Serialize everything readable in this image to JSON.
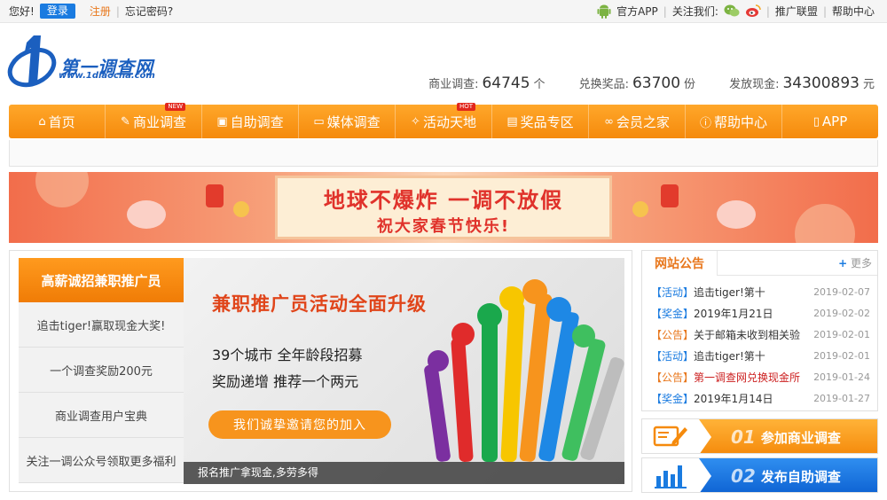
{
  "topbar": {
    "greeting": "您好!",
    "login": "登录",
    "register": "注册",
    "forgot": "忘记密码?",
    "app_label": "官方APP",
    "follow_label": "关注我们:",
    "affiliate": "推广联盟",
    "help": "帮助中心"
  },
  "logo": {
    "name": "第一调查网",
    "url": "www.1diaocha.com"
  },
  "stats": [
    {
      "label": "商业调查:",
      "value": "64745",
      "unit": "个"
    },
    {
      "label": "兑换奖品:",
      "value": "63700",
      "unit": "份"
    },
    {
      "label": "发放现金:",
      "value": "34300893",
      "unit": "元"
    }
  ],
  "nav": [
    {
      "label": "首页",
      "icon": "home-icon",
      "glyph": "⌂"
    },
    {
      "label": "商业调查",
      "icon": "pen-icon",
      "glyph": "✎",
      "badge": "NEW"
    },
    {
      "label": "自助调查",
      "icon": "box-icon",
      "glyph": "▣"
    },
    {
      "label": "媒体调查",
      "icon": "monitor-icon",
      "glyph": "▭"
    },
    {
      "label": "活动天地",
      "icon": "activity-icon",
      "glyph": "✧",
      "badge": "HOT"
    },
    {
      "label": "奖品专区",
      "icon": "gift-icon",
      "glyph": "▤"
    },
    {
      "label": "会员之家",
      "icon": "members-icon",
      "glyph": "∞"
    },
    {
      "label": "帮助中心",
      "icon": "help-icon",
      "glyph": "ⓘ"
    },
    {
      "label": "APP",
      "icon": "phone-icon",
      "glyph": "▯"
    }
  ],
  "banner": {
    "line1": "地球不爆炸 一调不放假",
    "line2": "祝大家春节快乐!"
  },
  "sidemenu": {
    "head": "高薪诚招兼职推广员",
    "items": [
      "追击tiger!赢取现金大奖!",
      "一个调查奖励200元",
      "商业调查用户宝典",
      "关注一调公众号领取更多福利"
    ]
  },
  "promo": {
    "headline": "兼职推广员活动全面升级",
    "line1": "39个城市 全年龄段招募",
    "line2": "奖励递增 推荐一个两元",
    "cta": "我们诚挚邀请您的加入",
    "caption": "报名推广拿现金,多劳多得"
  },
  "notice": {
    "title": "网站公告",
    "more": "更多",
    "items": [
      {
        "tag": "【活动】",
        "text": "追击tiger!第十",
        "date": "2019-02-07",
        "tag_color": "blue",
        "red": false
      },
      {
        "tag": "【奖金】",
        "text": "2019年1月21日",
        "date": "2019-02-02",
        "tag_color": "blue",
        "red": false
      },
      {
        "tag": "【公告】",
        "text": "关于邮箱未收到相关验",
        "date": "2019-02-01",
        "tag_color": "orange",
        "red": false
      },
      {
        "tag": "【活动】",
        "text": "追击tiger!第十",
        "date": "2019-02-01",
        "tag_color": "blue",
        "red": false
      },
      {
        "tag": "【公告】",
        "text": "第一调查网兑换现金所",
        "date": "2019-01-24",
        "tag_color": "orange",
        "red": true
      },
      {
        "tag": "【奖金】",
        "text": "2019年1月14日",
        "date": "2019-01-27",
        "tag_color": "blue",
        "red": false
      }
    ]
  },
  "actions": [
    {
      "num": "01",
      "label": "参加商业调查"
    },
    {
      "num": "02",
      "label": "发布自助调查"
    }
  ],
  "colors": {
    "brand_orange": "#f58a0c",
    "brand_blue": "#1a7be0",
    "notice_red": "#cc1f1f"
  }
}
